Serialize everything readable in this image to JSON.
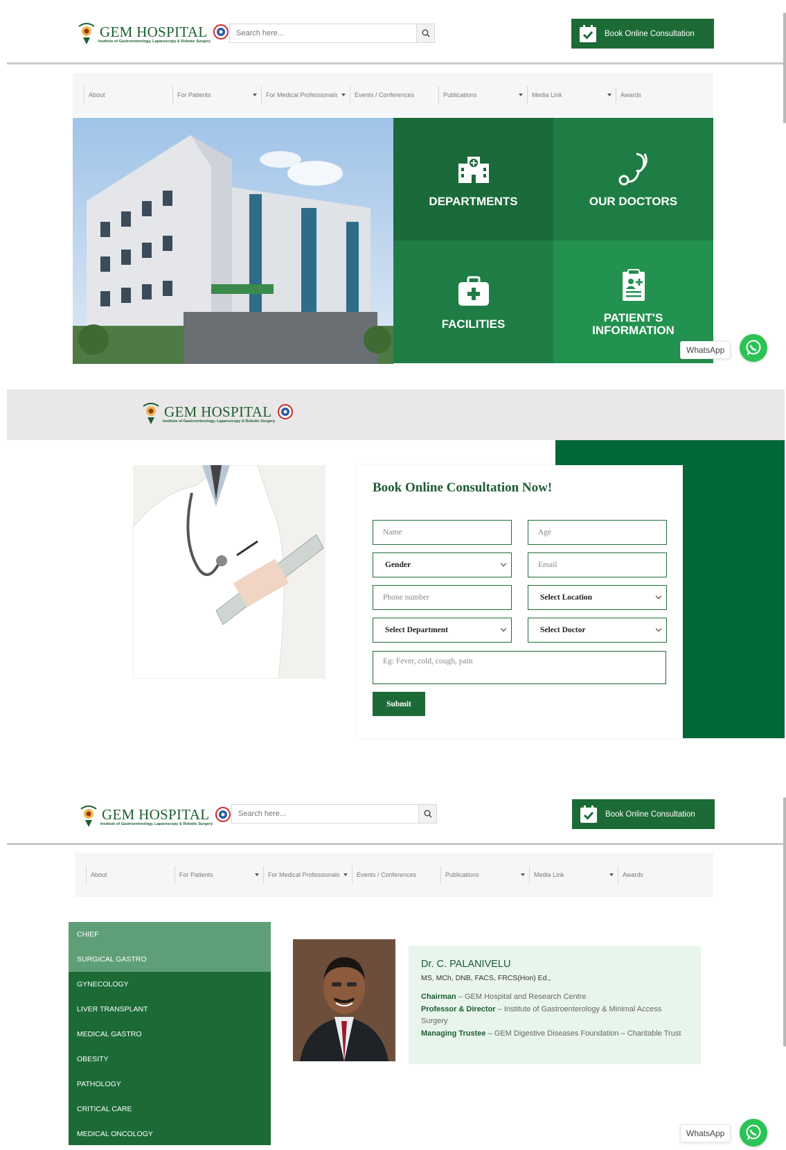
{
  "header": {
    "logo_title": "GEM HOSPITAL",
    "logo_subtitle": "Institute of Gastroenterology, Laparoscopy & Robotic Surgery",
    "search_placeholder": "Search here...",
    "book_button_label": "Book Online Consultation"
  },
  "nav": {
    "items": [
      {
        "label": "About",
        "has_dropdown": false
      },
      {
        "label": "For Patients",
        "has_dropdown": true
      },
      {
        "label": "For Medical Professionals",
        "has_dropdown": true
      },
      {
        "label": "Events / Conferences",
        "has_dropdown": false
      },
      {
        "label": "Publications",
        "has_dropdown": true
      },
      {
        "label": "Media Link",
        "has_dropdown": true
      },
      {
        "label": "Awards",
        "has_dropdown": false
      }
    ]
  },
  "hero": {
    "tiles": {
      "departments": "DEPARTMENTS",
      "doctors": "OUR DOCTORS",
      "facilities": "FACILITIES",
      "patient_info_line1": "PATIENT'S",
      "patient_info_line2": "INFORMATION"
    }
  },
  "whatsapp_label": "WhatsApp",
  "booking": {
    "title": "Book Online Consultation Now!",
    "name_placeholder": "Name",
    "age_placeholder": "Age",
    "gender_select": "Gender",
    "email_placeholder": "Email",
    "phone_placeholder": "Phone number",
    "location_select": "Select Location",
    "department_select": "Select Department",
    "doctor_select": "Select Doctor",
    "symptoms_placeholder": "Eg: Fever, cold, cough, pain",
    "submit_label": "Submit"
  },
  "sidebar": {
    "items": [
      "CHIEF",
      "SURGICAL GASTRO",
      "GYNECOLOGY",
      "LIVER TRANSPLANT",
      "MEDICAL GASTRO",
      "OBESITY",
      "PATHOLOGY",
      "CRITICAL CARE",
      "MEDICAL ONCOLOGY"
    ],
    "active_index": 1
  },
  "doctor": {
    "name": "Dr. C. PALANIVELU",
    "qualifications": "MS, MCh, DNB, FACS, FRCS(Hon) Ed.,",
    "roles": [
      {
        "title": "Chairman",
        "detail": "– GEM Hospital and Research Centre"
      },
      {
        "title": "Professor & Director",
        "detail": "– Institute of Gastroenterology & Minimal Access Surgery"
      },
      {
        "title": "Managing Trustee",
        "detail": "– GEM Digestive Diseases Foundation – Charitable Trust"
      }
    ]
  },
  "colors": {
    "brand_green": "#1c6b37",
    "tile_dark": "#1b6a3a",
    "tile_mid": "#1e7d45",
    "tile_light": "#23914f",
    "form_band_green": "#006837",
    "whatsapp": "#2cc356"
  }
}
